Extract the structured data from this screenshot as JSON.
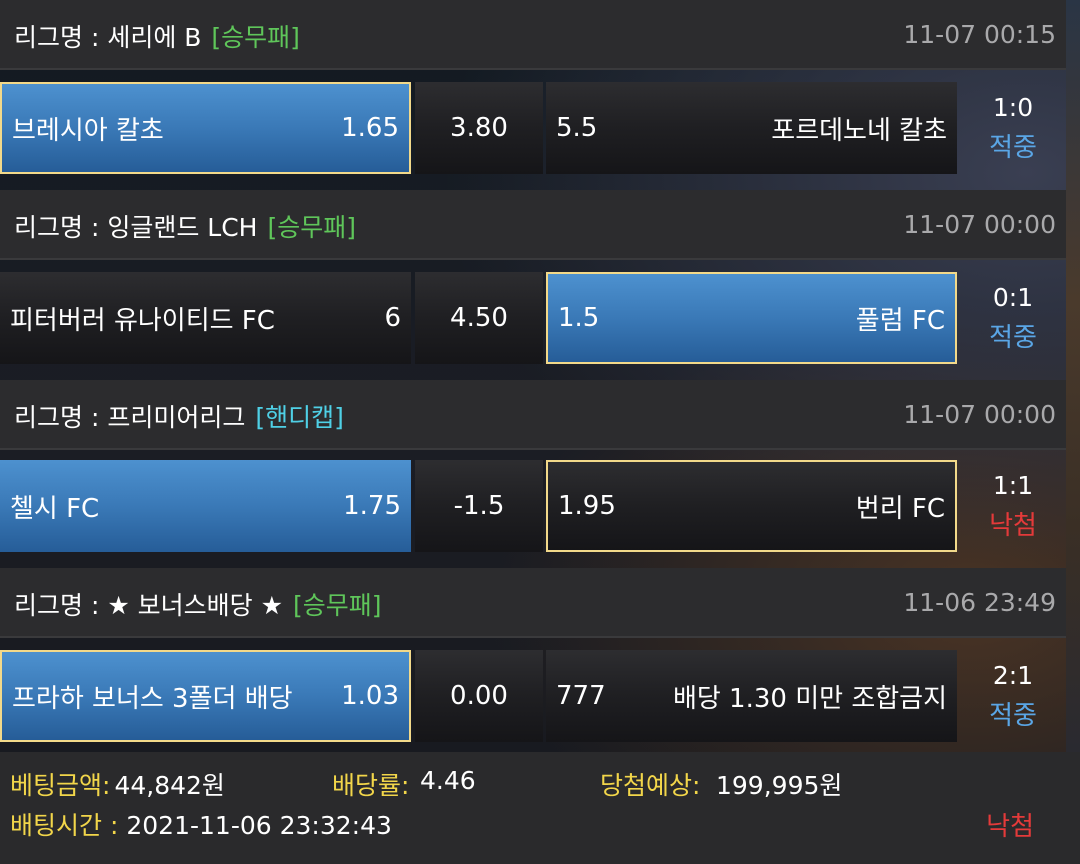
{
  "matches": [
    {
      "league_label": "리그명 : 세리에 B",
      "bet_type": "[승무패]",
      "datetime": "11-07 00:15",
      "home_team": "브레시아 칼초",
      "home_odds": "1.65",
      "middle": "3.80",
      "away_odds": "5.5",
      "away_team": "포르데노네 칼초",
      "score": "1:0",
      "status": "적중",
      "selected": "home"
    },
    {
      "league_label": "리그명 : 잉글랜드 LCH",
      "bet_type": "[승무패]",
      "datetime": "11-07 00:00",
      "home_team": "피터버러 유나이티드 FC",
      "home_odds": "6",
      "middle": "4.50",
      "away_odds": "1.5",
      "away_team": "풀럼 FC",
      "score": "0:1",
      "status": "적중",
      "selected": "away"
    },
    {
      "league_label": "리그명 : 프리미어리그",
      "bet_type": "[핸디캡]",
      "datetime": "11-07 00:00",
      "home_team": "첼시 FC",
      "home_odds": "1.75",
      "middle": "-1.5",
      "away_odds": "1.95",
      "away_team": "번리 FC",
      "score": "1:1",
      "status": "낙첨",
      "selected": "home"
    },
    {
      "league_label": "리그명 : ★ 보너스배당 ★",
      "bet_type": "[승무패]",
      "datetime": "11-06 23:49",
      "home_team": "프라하 보너스 3폴더 배당",
      "home_odds": "1.03",
      "middle": "0.00",
      "away_odds": "777",
      "away_team": "배당 1.30 미만 조합금지",
      "score": "2:1",
      "status": "적중",
      "selected": "home"
    }
  ],
  "summary": {
    "bet_amount_label": "베팅금액:",
    "bet_amount": "44,842원",
    "odds_rate_label": "배당률:",
    "odds_rate": "4.46",
    "expected_win_label": "당첨예상:",
    "expected_win": "199,995원",
    "bet_time_label": "배팅시간 :",
    "bet_time": "2021-11-06 23:32:43",
    "outcome": "낙첨"
  },
  "colors": {
    "selected_bg": "#3a79b7",
    "selected_border": "#f2d98a",
    "hit": "#5aa6e6",
    "miss": "#e43a3a",
    "tag_green": "#5fc65a",
    "tag_cyan": "#4fd0e6",
    "footer_label": "#f2d64a"
  }
}
